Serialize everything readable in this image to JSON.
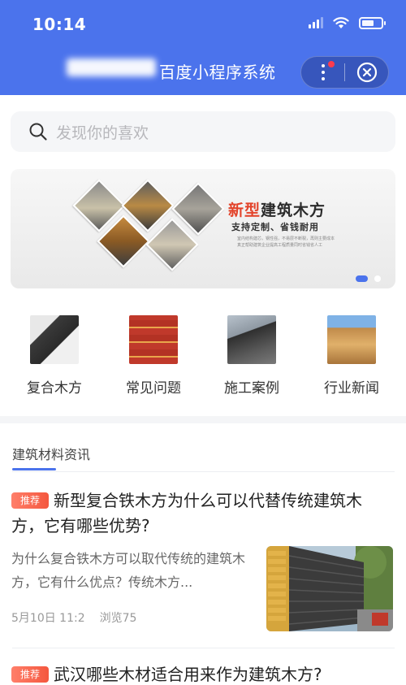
{
  "status_bar": {
    "time": "10:14"
  },
  "header": {
    "title": "百度小程序系统"
  },
  "search": {
    "placeholder": "发现你的喜欢"
  },
  "banner": {
    "title_accent": "新型",
    "title_rest": "建筑木方",
    "subtitle": "支持定制、省钱耐用",
    "small_line1": "室内结构建芯，钢性强，不易层不断裂，再则主要成本",
    "small_line2": "真正帮助建筑企业提高工程质量同时省钱省人工",
    "slides": 2,
    "active_slide": 1
  },
  "categories": [
    {
      "label": "复合木方"
    },
    {
      "label": "常见问题"
    },
    {
      "label": "施工案例"
    },
    {
      "label": "行业新闻"
    }
  ],
  "news": {
    "section_title": "建筑材料资讯",
    "articles": [
      {
        "tag": "推荐",
        "title": "新型复合铁木方为什么可以代替传统建筑木方，它有哪些优势?",
        "summary": "为什么复合铁木方可以取代传统的建筑木方，它有什么优点？传统木方...",
        "date": "5月10日 11:2",
        "views": "浏览75"
      },
      {
        "tag": "推荐",
        "title": "武汉哪些木材适合用来作为建筑木方?"
      }
    ]
  },
  "colors": {
    "brand": "#4b73ec",
    "tag": "#f4573e",
    "notify_dot": "#ff3b4e"
  }
}
